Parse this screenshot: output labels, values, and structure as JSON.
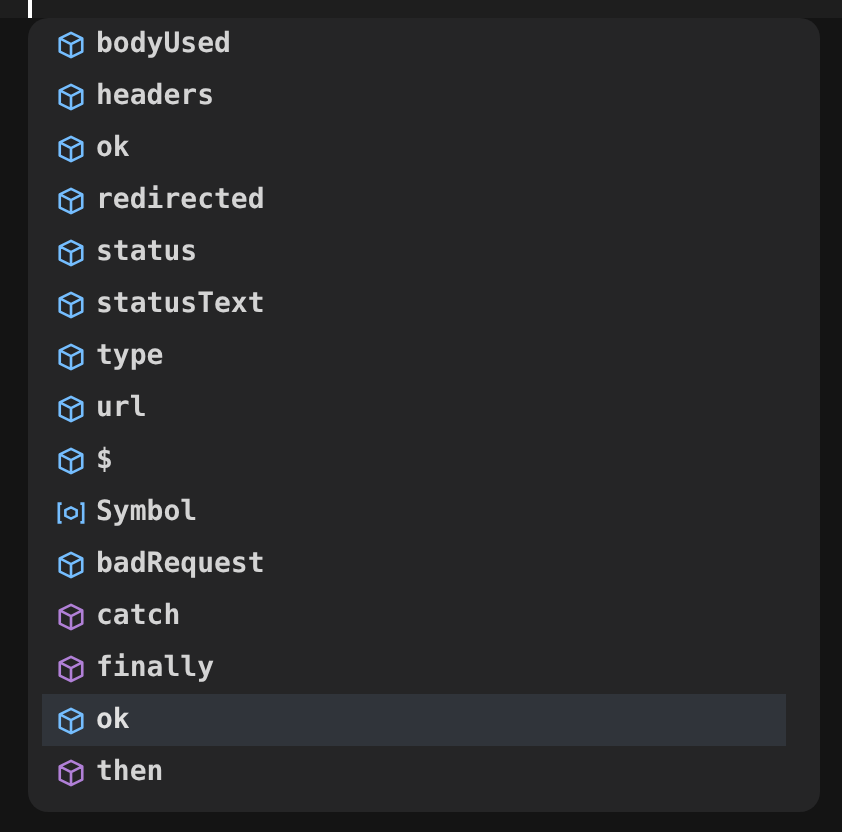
{
  "suggestions": [
    {
      "label": "bodyUsed",
      "kind": "property",
      "selected": false
    },
    {
      "label": "headers",
      "kind": "property",
      "selected": false
    },
    {
      "label": "ok",
      "kind": "property",
      "selected": false
    },
    {
      "label": "redirected",
      "kind": "property",
      "selected": false
    },
    {
      "label": "status",
      "kind": "property",
      "selected": false
    },
    {
      "label": "statusText",
      "kind": "property",
      "selected": false
    },
    {
      "label": "type",
      "kind": "property",
      "selected": false
    },
    {
      "label": "url",
      "kind": "property",
      "selected": false
    },
    {
      "label": "$",
      "kind": "property",
      "selected": false
    },
    {
      "label": "Symbol",
      "kind": "variable",
      "selected": false
    },
    {
      "label": "badRequest",
      "kind": "property",
      "selected": false
    },
    {
      "label": "catch",
      "kind": "method",
      "selected": false
    },
    {
      "label": "finally",
      "kind": "method",
      "selected": false
    },
    {
      "label": "ok",
      "kind": "property",
      "selected": true
    },
    {
      "label": "then",
      "kind": "method",
      "selected": false
    }
  ]
}
